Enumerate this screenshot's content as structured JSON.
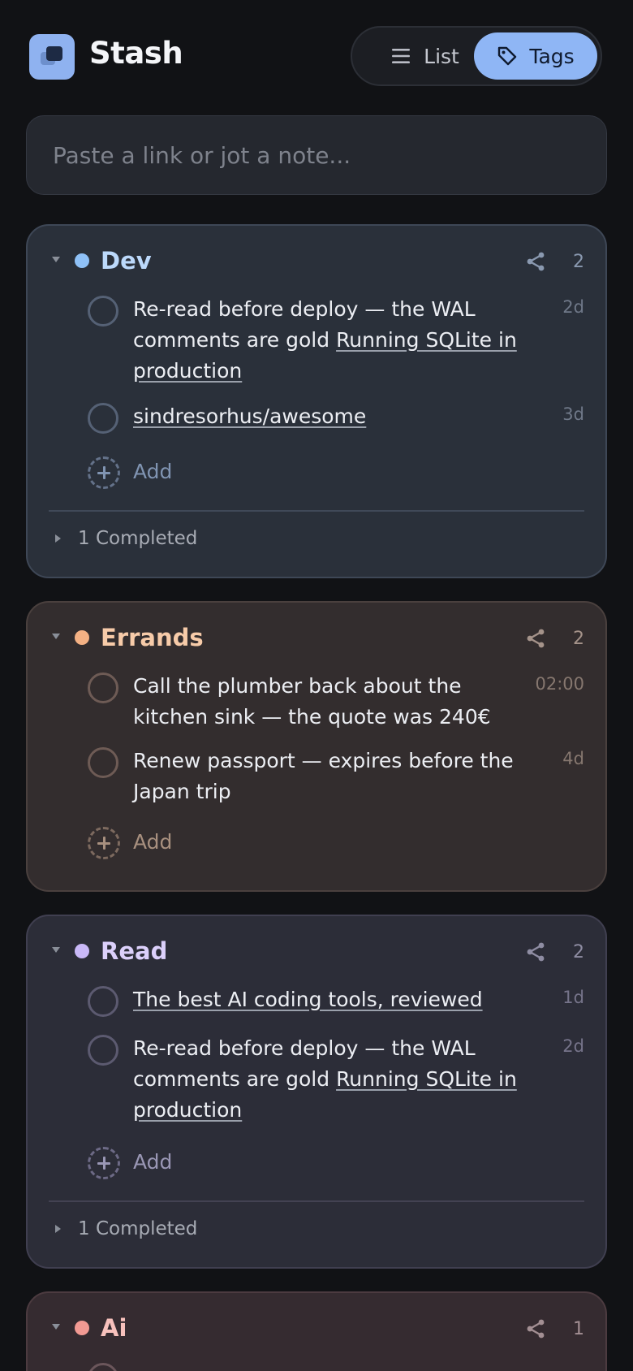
{
  "app": {
    "title": "Stash"
  },
  "view_toggle": {
    "list_label": "List",
    "tags_label": "Tags",
    "active": "Tags"
  },
  "composer": {
    "placeholder": "Paste a link or jot a note..."
  },
  "groups": [
    {
      "name": "Dev",
      "count": "2",
      "color": "#8fc1f7",
      "items": [
        {
          "text": "Re-read before deploy — the WAL comments are gold",
          "link": "Running SQLite in production",
          "meta": "2d"
        },
        {
          "text": "",
          "link": "sindresorhus/awesome",
          "meta": "3d"
        }
      ],
      "add_label": "Add",
      "completed_label": "1 Completed"
    },
    {
      "name": "Errands",
      "count": "2",
      "color": "#f4b184",
      "items": [
        {
          "text": "Call the plumber back about the kitchen sink — the quote was 240€",
          "link": "",
          "meta": "02:00"
        },
        {
          "text": "Renew passport — expires before the Japan trip",
          "link": "",
          "meta": "4d"
        }
      ],
      "add_label": "Add"
    },
    {
      "name": "Read",
      "count": "2",
      "color": "#c9b8f7",
      "items": [
        {
          "text": "",
          "link": "The best AI coding tools, reviewed",
          "meta": "1d"
        },
        {
          "text": "Re-read before deploy — the WAL comments are gold",
          "link": "Running SQLite in production",
          "meta": "2d"
        }
      ],
      "add_label": "Add",
      "completed_label": "1 Completed"
    },
    {
      "name": "Ai",
      "count": "1",
      "color": "#f29a93",
      "items": []
    }
  ]
}
